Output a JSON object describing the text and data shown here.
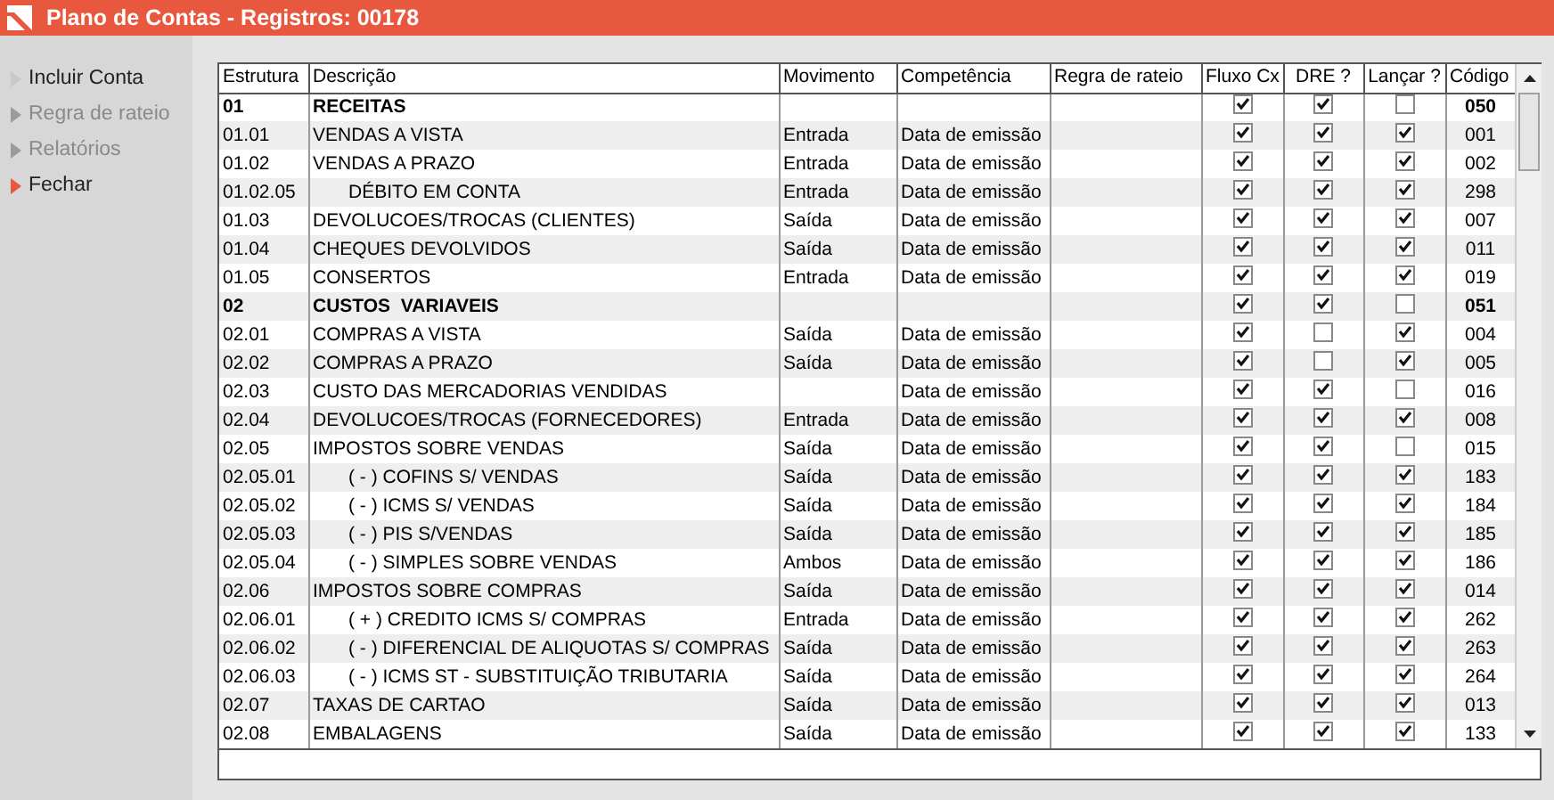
{
  "window": {
    "title": "Plano de Contas - Registros: 00178"
  },
  "sidebar": {
    "items": [
      {
        "label": "Incluir Conta",
        "disabled": false,
        "selected": false
      },
      {
        "label": "Regra de rateio",
        "disabled": true,
        "selected": false
      },
      {
        "label": "Relatórios",
        "disabled": true,
        "selected": false
      },
      {
        "label": "Fechar",
        "disabled": false,
        "selected": true
      }
    ]
  },
  "table": {
    "columns": [
      "Estrutura",
      "Descrição",
      "Movimento",
      "Competência",
      "Regra de rateio",
      "Fluxo Cx",
      "DRE ?",
      "Lançar ?",
      "Código"
    ],
    "rows": [
      {
        "kind": "group",
        "estrutura": "01",
        "descricao": "RECEITAS",
        "fluxo_cx": true,
        "dre": true,
        "lancar": false,
        "codigo": "050",
        "children": [
          {
            "kind": "account",
            "estrutura": "01.01",
            "descricao": "VENDAS A VISTA",
            "movimento": "Entrada",
            "competencia": "Data de emissão",
            "fluxo_cx": true,
            "dre": true,
            "lancar": true,
            "codigo": "001"
          },
          {
            "kind": "account",
            "estrutura": "01.02",
            "descricao": "VENDAS A PRAZO",
            "movimento": "Entrada",
            "competencia": "Data de emissão",
            "fluxo_cx": true,
            "dre": true,
            "lancar": true,
            "codigo": "002",
            "children": [
              {
                "kind": "account",
                "estrutura": "01.02.05",
                "descricao": "DÉBITO EM CONTA",
                "movimento": "Entrada",
                "competencia": "Data de emissão",
                "fluxo_cx": true,
                "dre": true,
                "lancar": true,
                "codigo": "298"
              }
            ]
          },
          {
            "kind": "account",
            "estrutura": "01.03",
            "descricao": "DEVOLUCOES/TROCAS (CLIENTES)",
            "movimento": "Saída",
            "competencia": "Data de emissão",
            "fluxo_cx": true,
            "dre": true,
            "lancar": true,
            "codigo": "007"
          },
          {
            "kind": "account",
            "estrutura": "01.04",
            "descricao": "CHEQUES DEVOLVIDOS",
            "movimento": "Saída",
            "competencia": "Data de emissão",
            "fluxo_cx": true,
            "dre": true,
            "lancar": true,
            "codigo": "011"
          },
          {
            "kind": "account",
            "estrutura": "01.05",
            "descricao": "CONSERTOS",
            "movimento": "Entrada",
            "competencia": "Data de emissão",
            "fluxo_cx": true,
            "dre": true,
            "lancar": true,
            "codigo": "019"
          }
        ]
      },
      {
        "kind": "group",
        "estrutura": "02",
        "descricao": "CUSTOS  VARIAVEIS",
        "fluxo_cx": true,
        "dre": true,
        "lancar": false,
        "codigo": "051",
        "children": [
          {
            "kind": "account",
            "estrutura": "02.01",
            "descricao": "COMPRAS A VISTA",
            "movimento": "Saída",
            "competencia": "Data de emissão",
            "fluxo_cx": true,
            "dre": false,
            "lancar": true,
            "codigo": "004"
          },
          {
            "kind": "account",
            "estrutura": "02.02",
            "descricao": "COMPRAS A PRAZO",
            "movimento": "Saída",
            "competencia": "Data de emissão",
            "fluxo_cx": true,
            "dre": false,
            "lancar": true,
            "codigo": "005"
          },
          {
            "kind": "account",
            "estrutura": "02.03",
            "descricao": "CUSTO DAS MERCADORIAS VENDIDAS",
            "competencia": "Data de emissão",
            "fluxo_cx": true,
            "dre": true,
            "lancar": false,
            "codigo": "016"
          },
          {
            "kind": "account",
            "estrutura": "02.04",
            "descricao": "DEVOLUCOES/TROCAS (FORNECEDORES)",
            "movimento": "Entrada",
            "competencia": "Data de emissão",
            "fluxo_cx": true,
            "dre": true,
            "lancar": true,
            "codigo": "008"
          },
          {
            "kind": "account",
            "estrutura": "02.05",
            "descricao": "IMPOSTOS SOBRE VENDAS",
            "movimento": "Saída",
            "competencia": "Data de emissão",
            "fluxo_cx": true,
            "dre": true,
            "lancar": false,
            "codigo": "015",
            "children": [
              {
                "kind": "account",
                "estrutura": "02.05.01",
                "descricao": "( - ) COFINS S/ VENDAS",
                "movimento": "Saída",
                "competencia": "Data de emissão",
                "fluxo_cx": true,
                "dre": true,
                "lancar": true,
                "codigo": "183"
              },
              {
                "kind": "account",
                "estrutura": "02.05.02",
                "descricao": "( - ) ICMS S/ VENDAS",
                "movimento": "Saída",
                "competencia": "Data de emissão",
                "fluxo_cx": true,
                "dre": true,
                "lancar": true,
                "codigo": "184"
              },
              {
                "kind": "account",
                "estrutura": "02.05.03",
                "descricao": "( - ) PIS S/VENDAS",
                "movimento": "Saída",
                "competencia": "Data de emissão",
                "fluxo_cx": true,
                "dre": true,
                "lancar": true,
                "codigo": "185"
              },
              {
                "kind": "account",
                "estrutura": "02.05.04",
                "descricao": "( - ) SIMPLES SOBRE VENDAS",
                "movimento": "Ambos",
                "competencia": "Data de emissão",
                "fluxo_cx": true,
                "dre": true,
                "lancar": true,
                "codigo": "186"
              }
            ]
          },
          {
            "kind": "account",
            "estrutura": "02.06",
            "descricao": "IMPOSTOS SOBRE COMPRAS",
            "movimento": "Saída",
            "competencia": "Data de emissão",
            "fluxo_cx": true,
            "dre": true,
            "lancar": true,
            "codigo": "014",
            "children": [
              {
                "kind": "account",
                "estrutura": "02.06.01",
                "descricao": "( + ) CREDITO ICMS S/ COMPRAS",
                "movimento": "Entrada",
                "competencia": "Data de emissão",
                "fluxo_cx": true,
                "dre": true,
                "lancar": true,
                "codigo": "262"
              },
              {
                "kind": "account",
                "estrutura": "02.06.02",
                "descricao": "( - ) DIFERENCIAL DE ALIQUOTAS S/ COMPRAS",
                "movimento": "Saída",
                "competencia": "Data de emissão",
                "fluxo_cx": true,
                "dre": true,
                "lancar": true,
                "codigo": "263"
              },
              {
                "kind": "account",
                "estrutura": "02.06.03",
                "descricao": "( - ) ICMS ST - SUBSTITUIÇÃO TRIBUTARIA",
                "movimento": "Saída",
                "competencia": "Data de emissão",
                "fluxo_cx": true,
                "dre": true,
                "lancar": true,
                "codigo": "264"
              }
            ]
          },
          {
            "kind": "account",
            "estrutura": "02.07",
            "descricao": "TAXAS DE CARTAO",
            "movimento": "Saída",
            "competencia": "Data de emissão",
            "fluxo_cx": true,
            "dre": true,
            "lancar": true,
            "codigo": "013"
          },
          {
            "kind": "account",
            "estrutura": "02.08",
            "descricao": "EMBALAGENS",
            "movimento": "Saída",
            "competencia": "Data de emissão",
            "fluxo_cx": true,
            "dre": true,
            "lancar": true,
            "codigo": "133"
          }
        ]
      }
    ]
  }
}
